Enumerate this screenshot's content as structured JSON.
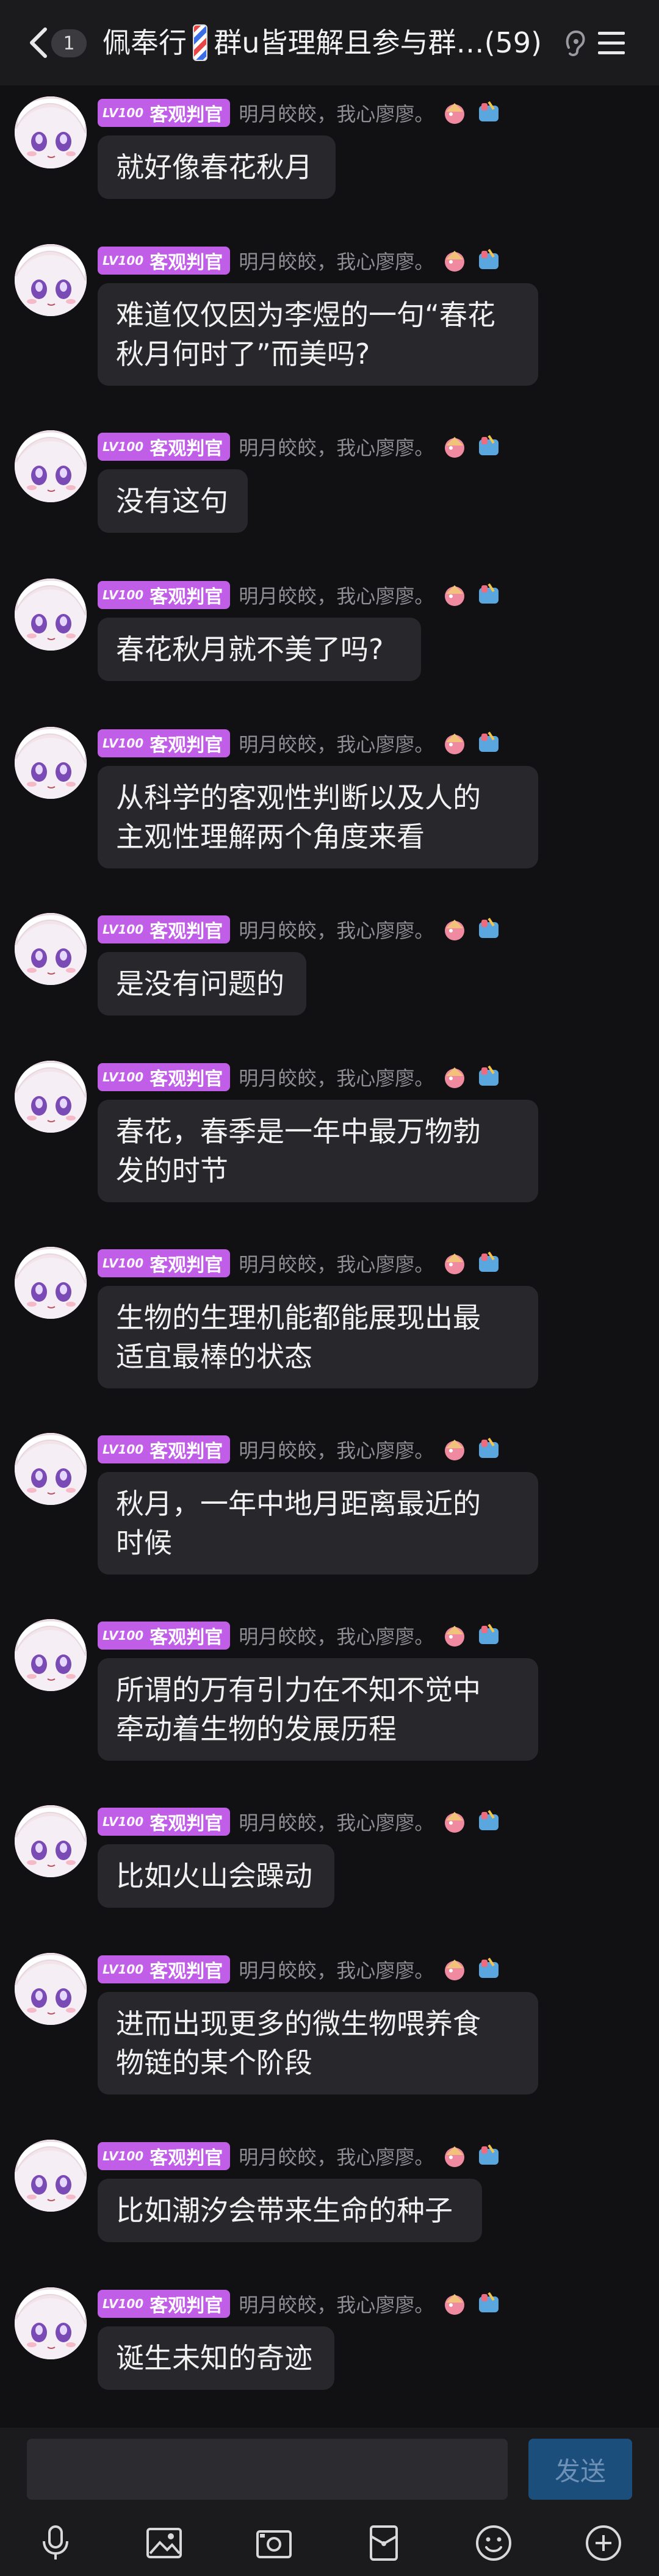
{
  "header": {
    "unread_count": "1",
    "title_part1": "佩奉行",
    "title_part2": "群u皆理解且参与群…",
    "member_count": "(59)"
  },
  "sender": {
    "level": "LV100",
    "title_badge": "客观判官",
    "nickname": "明月皎皎，我心廖廖。"
  },
  "messages": [
    {
      "text": "就好像春花秋月"
    },
    {
      "text": "难道仅仅因为李煜的一句“春花\n秋月何时了”而美吗?"
    },
    {
      "text": "没有这句"
    },
    {
      "text": "春花秋月就不美了吗?"
    },
    {
      "text": "从科学的客观性判断以及人的\n主观性理解两个角度来看"
    },
    {
      "text": "是没有问题的"
    },
    {
      "text": "春花，春季是一年中最万物勃\n发的时节"
    },
    {
      "text": "生物的生理机能都能展现出最\n适宜最棒的状态"
    },
    {
      "text": "秋月，一年中地月距离最近的\n时候"
    },
    {
      "text": "所谓的万有引力在不知不觉中\n牵动着生物的发展历程"
    },
    {
      "text": "比如火山会躁动"
    },
    {
      "text": "进而出现更多的微生物喂养食\n物链的某个阶段"
    },
    {
      "text": "比如潮汐会带来生命的种子"
    },
    {
      "text": "诞生未知的奇迹"
    }
  ],
  "input": {
    "send_label": "发送"
  },
  "colors": {
    "badge": "#c15ee8",
    "bubble": "#28282c",
    "send": "#1c4e7b"
  }
}
